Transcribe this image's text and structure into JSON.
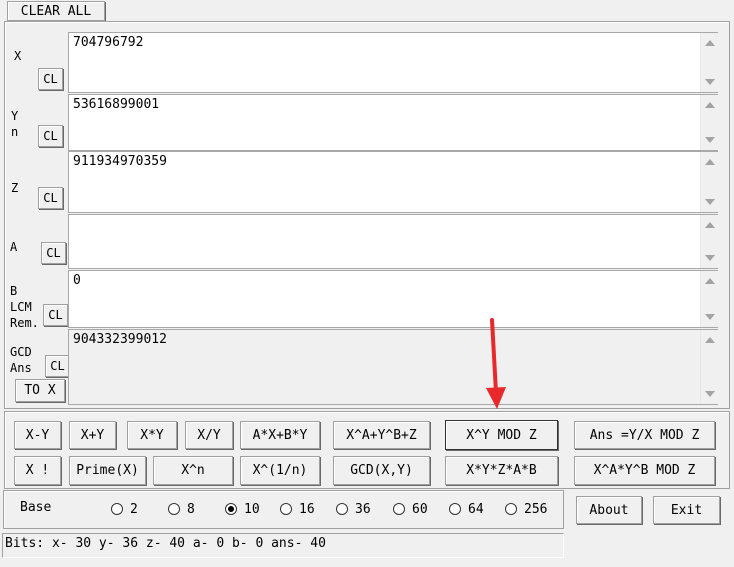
{
  "clear_all_label": "CLEAR ALL",
  "cl_label": "CL",
  "to_x_label": "TO X",
  "fields": {
    "x": {
      "label": "X",
      "value": "704796792"
    },
    "y": {
      "label": "Y\nn",
      "value": "53616899001"
    },
    "z": {
      "label": "Z",
      "value": "911934970359"
    },
    "a": {
      "label": "A",
      "value": ""
    },
    "b": {
      "label": "B\nLCM\nRem.",
      "value": "0"
    },
    "ans": {
      "label": "GCD\nAns",
      "value": "904332399012"
    }
  },
  "buttons": {
    "x_minus_y": "X-Y",
    "x_plus_y": "X+Y",
    "x_times_y": "X*Y",
    "x_div_y": "X/Y",
    "axby": "A*X+B*Y",
    "xa_yb_z": "X^A+Y^B+Z",
    "xy_mod_z": "X^Y MOD Z",
    "ans_yx_mod_z": "Ans =Y/X MOD Z",
    "x_fact": "X !",
    "prime_x": "Prime(X)",
    "x_pow_n": "X^n",
    "x_root_n": "X^(1/n)",
    "gcd_xy": "GCD(X,Y)",
    "xyzab": "X*Y*Z*A*B",
    "xa_yb_mod_z": "X^A*Y^B MOD Z",
    "about": "About",
    "exit": "Exit"
  },
  "base": {
    "label": "Base",
    "options": [
      "2",
      "8",
      "10",
      "16",
      "36",
      "60",
      "64",
      "256"
    ],
    "selected": "10"
  },
  "status_text": "Bits: x- 30 y- 36 z- 40 a- 0 b- 0 ans- 40",
  "colors": {
    "annotation_arrow": "#e8282b"
  }
}
